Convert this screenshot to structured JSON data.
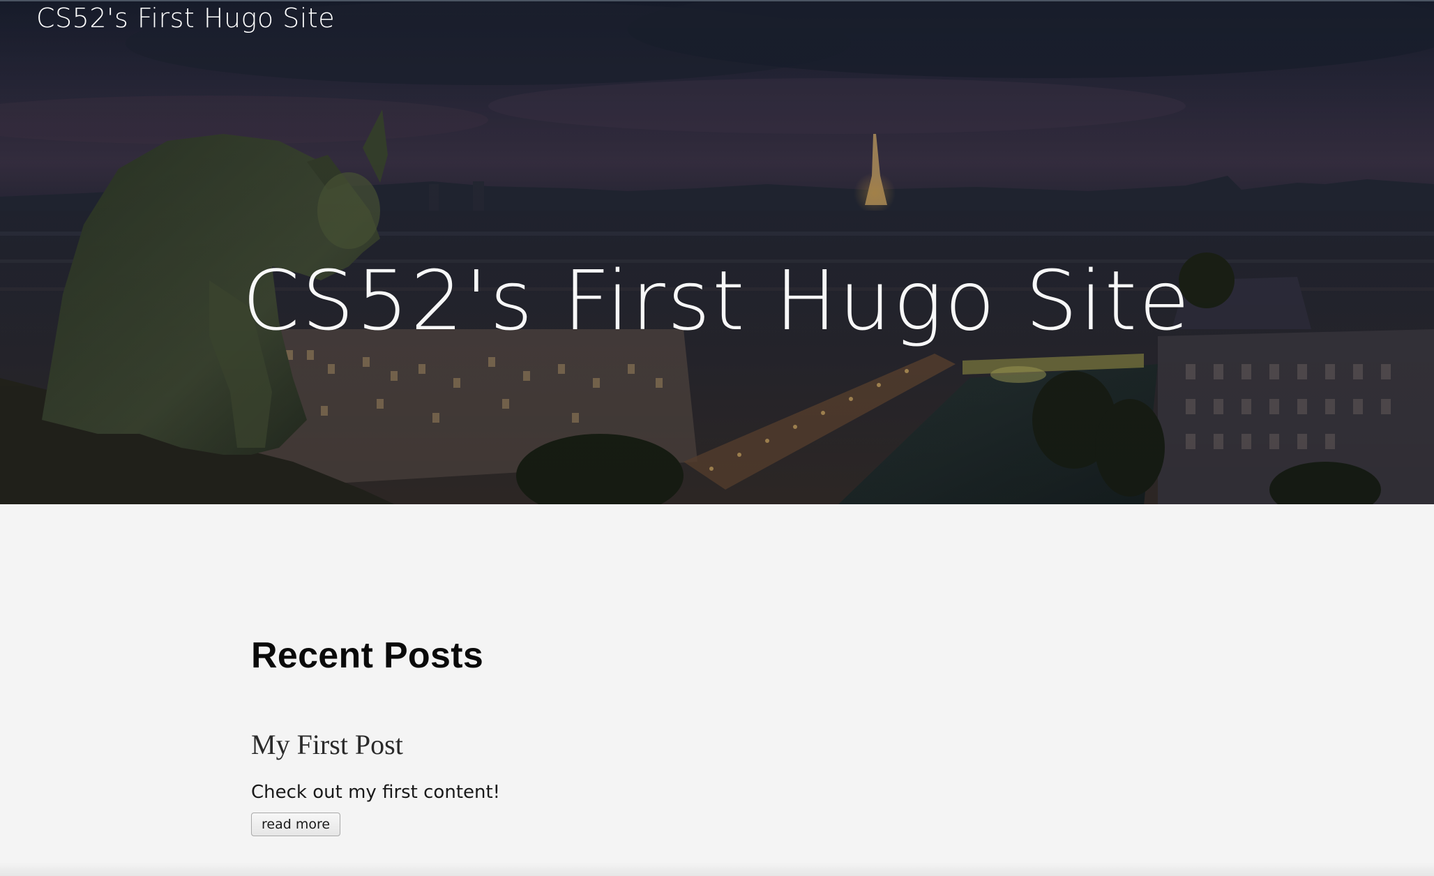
{
  "site": {
    "nav_title": "CS52's First Hugo Site",
    "hero_title": "CS52's First Hugo Site"
  },
  "main": {
    "section_title": "Recent Posts",
    "posts": [
      {
        "title": "My First Post",
        "summary": "Check out my first content!",
        "read_more_label": "read more"
      }
    ]
  },
  "colors": {
    "hero_sky_top": "#1c2233",
    "hero_sky_bottom": "#3a3345",
    "page_background": "#f4f4f4",
    "heading_text": "#0a0a0a"
  },
  "icons": {
    "hero_image": "paris-gargoyle-skyline-photo"
  }
}
